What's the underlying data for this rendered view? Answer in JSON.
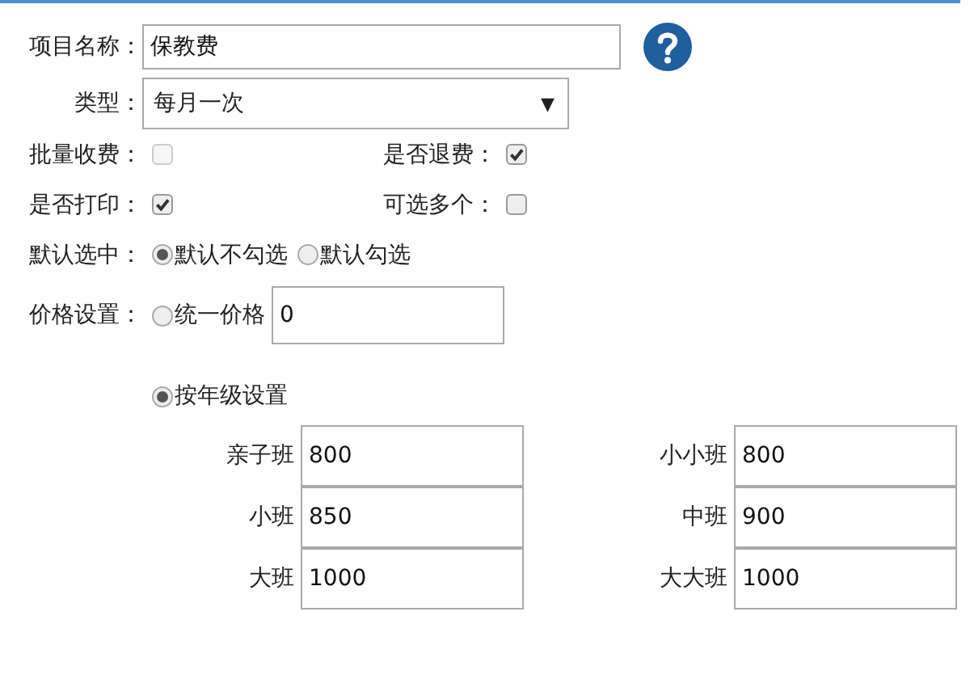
{
  "name_field": {
    "label": "项目名称：",
    "value": "保教费"
  },
  "type_field": {
    "label": "类型：",
    "value": "每月一次",
    "arrow": "▼"
  },
  "toggles": [
    {
      "label": "批量收费：",
      "checked": false,
      "disabled": true
    },
    {
      "label": "是否退费：",
      "checked": true,
      "disabled": false
    },
    {
      "label": "是否打印：",
      "checked": true,
      "disabled": false
    },
    {
      "label": "可选多个：",
      "checked": false,
      "disabled": false
    }
  ],
  "default_selection": {
    "label": "默认选中：",
    "options": [
      {
        "label": "默认不勾选",
        "selected": true
      },
      {
        "label": "默认勾选",
        "selected": false
      }
    ]
  },
  "price": {
    "label": "价格设置：",
    "options": [
      {
        "label": "统一价格",
        "selected": false,
        "value": "0"
      },
      {
        "label": "按年级设置",
        "selected": true
      }
    ],
    "grades": [
      {
        "name": "亲子班",
        "value": "800"
      },
      {
        "name": "小小班",
        "value": "800"
      },
      {
        "name": "小班",
        "value": "850"
      },
      {
        "name": "中班",
        "value": "900"
      },
      {
        "name": "大班",
        "value": "1000"
      },
      {
        "name": "大大班",
        "value": "1000"
      }
    ]
  }
}
